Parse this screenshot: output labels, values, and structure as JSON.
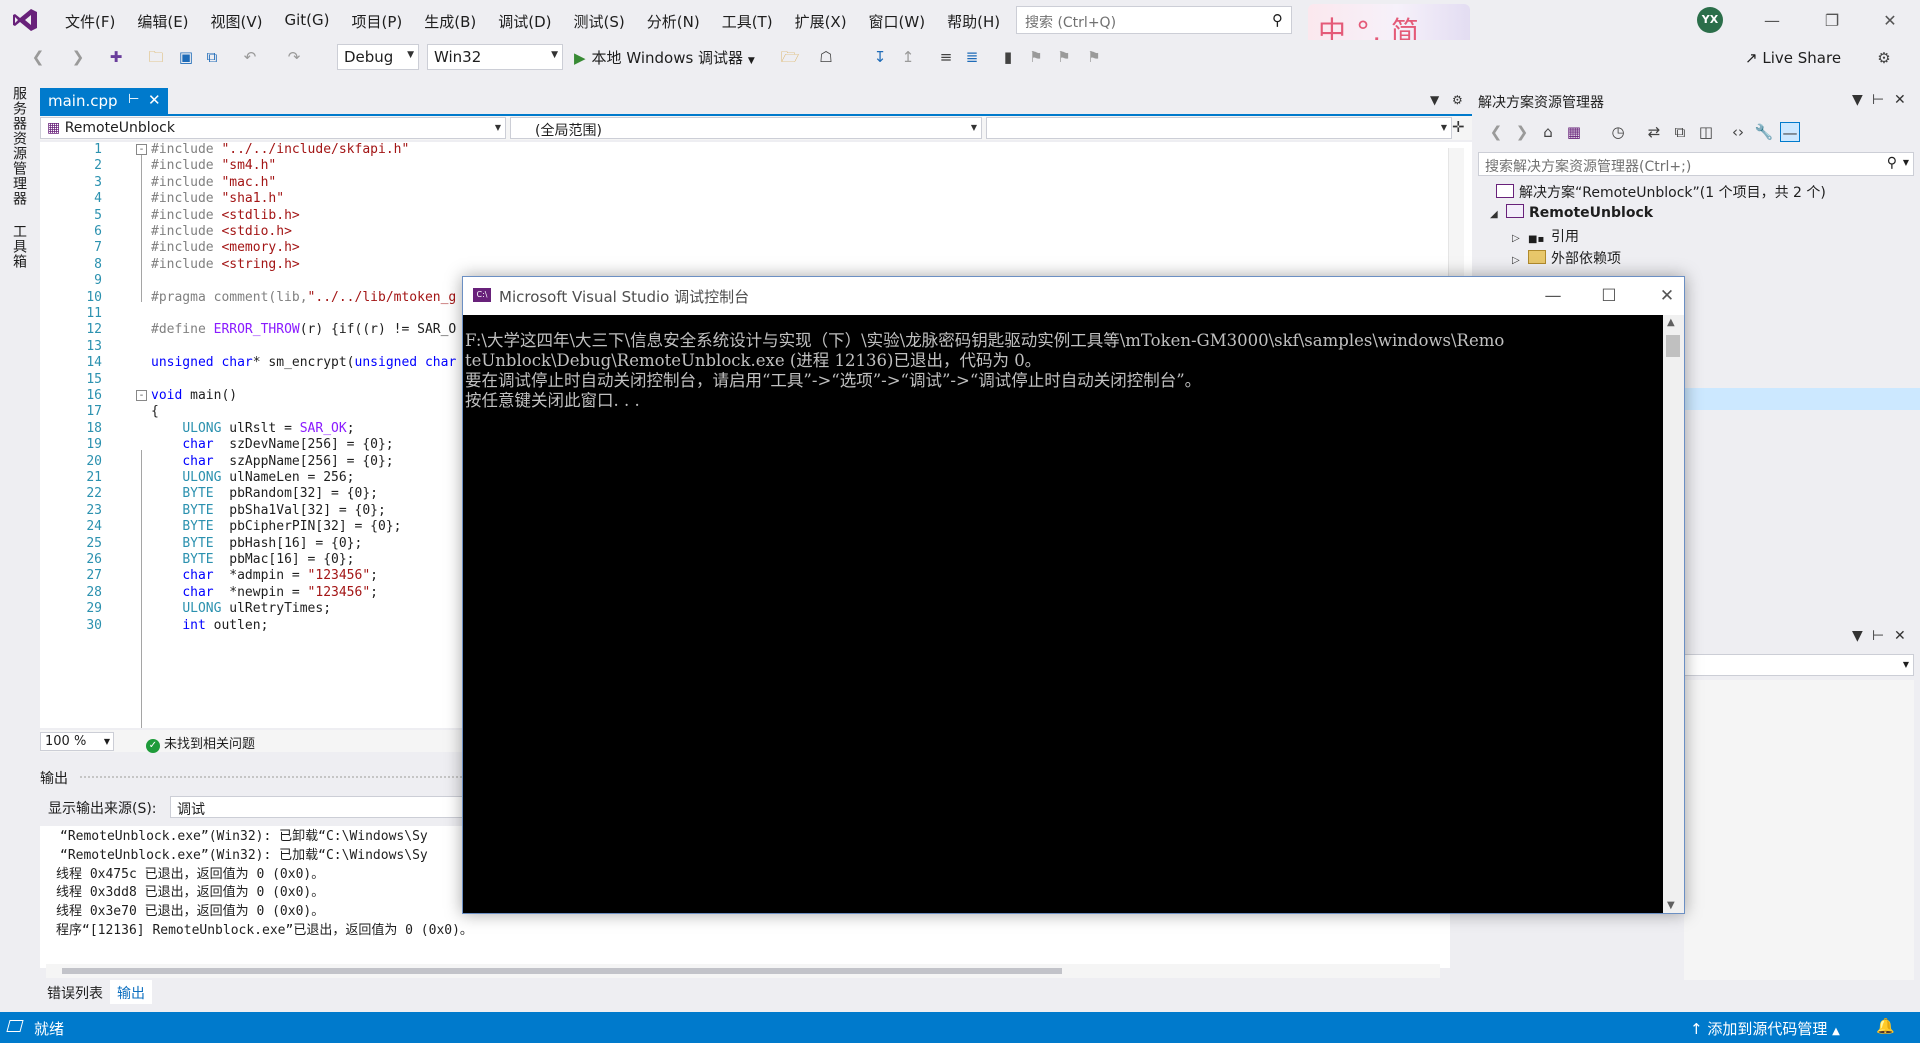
{
  "menu": [
    "文件(F)",
    "编辑(E)",
    "视图(V)",
    "Git(G)",
    "项目(P)",
    "生成(B)",
    "调试(D)",
    "测试(S)",
    "分析(N)",
    "工具(T)",
    "扩展(X)",
    "窗口(W)",
    "帮助(H)"
  ],
  "search": {
    "placeholder": "搜索 (Ctrl+Q)"
  },
  "ime": {
    "char1": "中",
    "char2": "°,",
    "char3": "简"
  },
  "user": {
    "initials": "YX"
  },
  "toolbar": {
    "config": "Debug",
    "platform": "Win32",
    "run_label": "本地 Windows 调试器",
    "live_share": "Live Share"
  },
  "left_strip": {
    "server_explorer": "服务器资源管理器",
    "toolbox": "工具箱"
  },
  "editor": {
    "tab_name": "main.cpp",
    "nav_project": "RemoteUnblock",
    "nav_scope": "(全局范围)",
    "nav_member": "",
    "zoom": "100 %",
    "issues": "未找到相关问题",
    "lines": [
      {
        "n": "1",
        "t": "#include \"../../include/skfapi.h\""
      },
      {
        "n": "2",
        "t": "#include \"sm4.h\""
      },
      {
        "n": "3",
        "t": "#include \"mac.h\""
      },
      {
        "n": "4",
        "t": "#include \"sha1.h\""
      },
      {
        "n": "5",
        "t": "#include <stdlib.h>"
      },
      {
        "n": "6",
        "t": "#include <stdio.h>"
      },
      {
        "n": "7",
        "t": "#include <memory.h>"
      },
      {
        "n": "8",
        "t": "#include <string.h>"
      },
      {
        "n": "9",
        "t": ""
      },
      {
        "n": "10",
        "t": "#pragma comment(lib,\"../../lib/mtoken_g"
      },
      {
        "n": "11",
        "t": ""
      },
      {
        "n": "12",
        "t": "#define ERROR_THROW(r) {if((r) != SAR_O"
      },
      {
        "n": "13",
        "t": ""
      },
      {
        "n": "14",
        "t": "unsigned char* sm_encrypt(unsigned char"
      },
      {
        "n": "15",
        "t": ""
      },
      {
        "n": "16",
        "t": "void main()"
      },
      {
        "n": "17",
        "t": "{"
      },
      {
        "n": "18",
        "t": "    ULONG ulRslt = SAR_OK;"
      },
      {
        "n": "19",
        "t": "    char  szDevName[256] = {0};"
      },
      {
        "n": "20",
        "t": "    char  szAppName[256] = {0};"
      },
      {
        "n": "21",
        "t": "    ULONG ulNameLen = 256;"
      },
      {
        "n": "22",
        "t": "    BYTE  pbRandom[32] = {0};"
      },
      {
        "n": "23",
        "t": "    BYTE  pbSha1Val[32] = {0};"
      },
      {
        "n": "24",
        "t": "    BYTE  pbCipherPIN[32] = {0};"
      },
      {
        "n": "25",
        "t": "    BYTE  pbHash[16] = {0};"
      },
      {
        "n": "26",
        "t": "    BYTE  pbMac[16] = {0};"
      },
      {
        "n": "27",
        "t": "    char  *admpin = \"123456\";"
      },
      {
        "n": "28",
        "t": "    char  *newpin = \"123456\";"
      },
      {
        "n": "29",
        "t": "    ULONG ulRetryTimes;"
      },
      {
        "n": "30",
        "t": "    int outlen;"
      }
    ]
  },
  "output": {
    "title": "输出",
    "source_label": "显示输出来源(S):",
    "source_value": "调试",
    "lines": [
      "“RemoteUnblock.exe”(Win32): 已卸载“C:\\Windows\\Sy",
      "“RemoteUnblock.exe”(Win32): 已加载“C:\\Windows\\Sy",
      "线程 0x475c 已退出，返回值为 0 (0x0)。",
      "线程 0x3dd8 已退出，返回值为 0 (0x0)。",
      "线程 0x3e70 已退出，返回值为 0 (0x0)。",
      "程序“[12136] RemoteUnblock.exe”已退出，返回值为 0 (0x0)。"
    ],
    "tabs": [
      "错误列表",
      "输出"
    ]
  },
  "solution_explorer": {
    "title": "解决方案资源管理器",
    "search_placeholder": "搜索解决方案资源管理器(Ctrl+;)",
    "solution": "解决方案“RemoteUnblock”(1 个项目，共 2 个)",
    "project": "RemoteUnblock",
    "references": "引用",
    "external_deps": "外部依赖项"
  },
  "console": {
    "title": "Microsoft Visual Studio 调试控制台",
    "lines": [
      "F:\\大学这四年\\大三下\\信息安全系统设计与实现（下）\\实验\\龙脉密码钥匙驱动实例工具等\\mToken-GM3000\\skf\\samples\\windows\\Remo",
      "teUnblock\\Debug\\RemoteUnblock.exe (进程 12136)已退出，代码为 0。",
      "要在调试停止时自动关闭控制台，请启用“工具”->“选项”->“调试”->“调试停止时自动关闭控制台”。",
      "按任意键关闭此窗口. . ."
    ]
  },
  "status": {
    "ready": "就绪",
    "source_control": "添加到源代码管理"
  },
  "colors": {
    "accent": "#007acc",
    "console_bg": "#000000",
    "console_text": "#c0c0c0"
  }
}
